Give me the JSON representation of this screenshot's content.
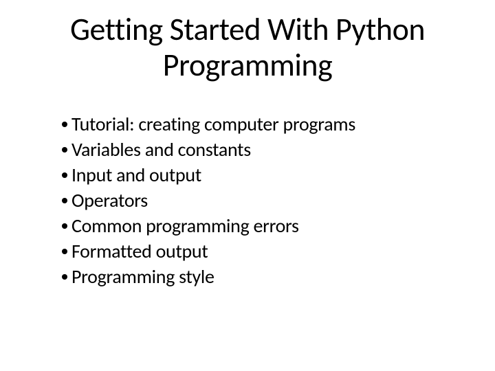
{
  "slide": {
    "title": "Getting Started With Python Programming",
    "bullets": [
      "Tutorial: creating computer programs",
      "Variables and constants",
      "Input and output",
      "Operators",
      "Common programming errors",
      "Formatted output",
      "Programming style"
    ]
  }
}
